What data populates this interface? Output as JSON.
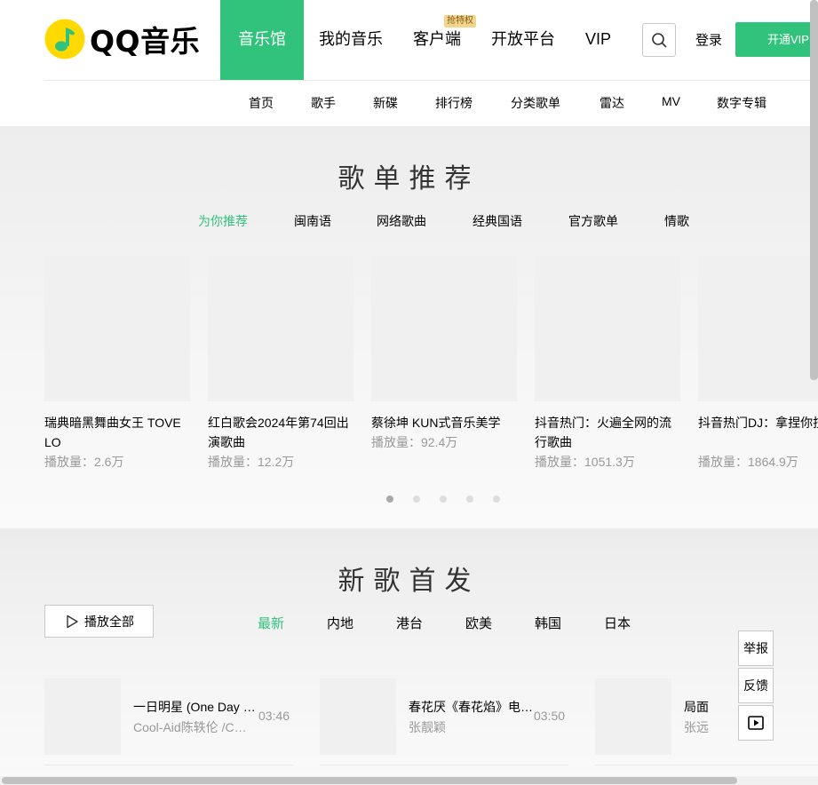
{
  "brand": {
    "name": "QQ音乐",
    "accent": "#31c27c",
    "logo_color": "#ffd900"
  },
  "top_nav": {
    "items": [
      {
        "label": "音乐馆",
        "active": true
      },
      {
        "label": "我的音乐"
      },
      {
        "label": "客户端",
        "tag": "抢特权"
      },
      {
        "label": "开放平台"
      },
      {
        "label": "VIP"
      }
    ],
    "search_icon": "search-icon",
    "login_label": "登录",
    "vip_button_label": "开通VIP"
  },
  "sub_nav": [
    "首页",
    "歌手",
    "新碟",
    "排行榜",
    "分类歌单",
    "雷达",
    "MV",
    "数字专辑"
  ],
  "playlists": {
    "title": "歌单推荐",
    "categories": [
      "为你推荐",
      "闽南语",
      "网络歌曲",
      "经典国语",
      "官方歌单",
      "情歌"
    ],
    "active_category": "为你推荐",
    "items": [
      {
        "title": "瑞典暗黑舞曲女王 TOVE LO",
        "plays": "播放量：2.6万"
      },
      {
        "title": "红白歌会2024年第74回出演歌曲",
        "plays": "播放量：12.2万"
      },
      {
        "title": "蔡徐坤 KUN式音乐美学",
        "plays": "播放量：92.4万"
      },
      {
        "title": "抖音热门：火遍全网的流行歌曲",
        "plays": "播放量：1051.3万"
      },
      {
        "title": "抖音热门DJ：拿捏你技",
        "plays": "播放量：1864.9万"
      }
    ],
    "carousel_pages": 5,
    "carousel_active": 1
  },
  "new_songs": {
    "title": "新歌首发",
    "play_all_label": "播放全部",
    "regions": [
      "最新",
      "内地",
      "港台",
      "欧美",
      "韩国",
      "日本"
    ],
    "active_region": "最新",
    "items": [
      {
        "name": "一日明星 (One Day Star)",
        "artist": "Cool-Aid陈轶伦 /C…",
        "duration": "03:46"
      },
      {
        "name": "春花厌《春花焰》电视剧主题曲",
        "artist": "张靓颖",
        "duration": "03:50"
      },
      {
        "name": "局面",
        "artist": "张远",
        "duration": ""
      }
    ]
  },
  "side_actions": {
    "report_label": "举报",
    "feedback_label": "反馈",
    "play_icon": "play-square-icon"
  }
}
